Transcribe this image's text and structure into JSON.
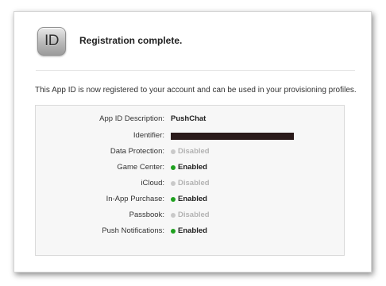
{
  "header": {
    "icon_text": "ID",
    "title": "Registration complete."
  },
  "intro": "This App ID is now registered to your account and can be used in your provisioning profiles.",
  "details": {
    "app_id_description": {
      "label": "App ID Description:",
      "value": "PushChat"
    },
    "identifier": {
      "label": "Identifier:",
      "value": ""
    },
    "data_protection": {
      "label": "Data Protection:",
      "status": "Disabled"
    },
    "game_center": {
      "label": "Game Center:",
      "status": "Enabled"
    },
    "icloud": {
      "label": "iCloud:",
      "status": "Disabled"
    },
    "in_app_purchase": {
      "label": "In-App Purchase:",
      "status": "Enabled"
    },
    "passbook": {
      "label": "Passbook:",
      "status": "Disabled"
    },
    "push_notifications": {
      "label": "Push Notifications:",
      "status": "Enabled"
    }
  },
  "colors": {
    "enabled_dot": "#1fa11f",
    "disabled_dot": "#c9c9c9",
    "disabled_text": "#b3b3b3"
  }
}
